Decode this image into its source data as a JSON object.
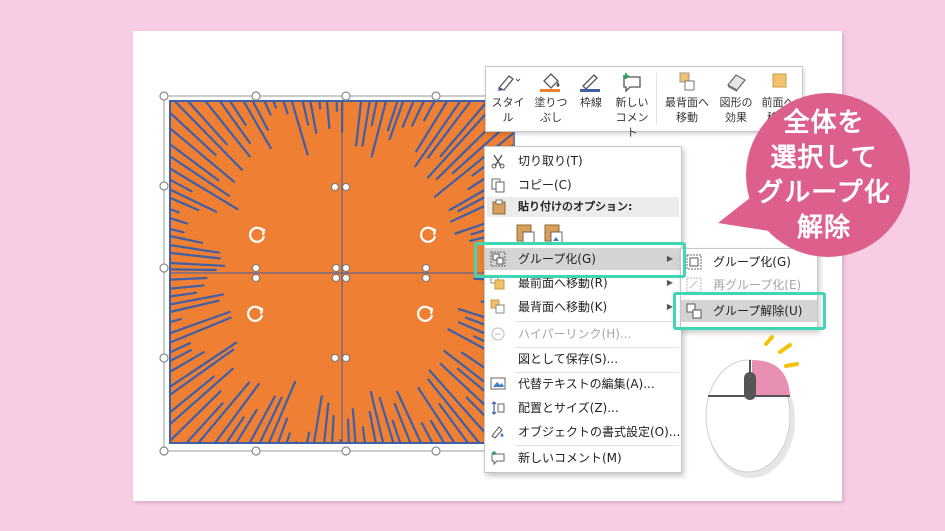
{
  "slide": {
    "colors": {
      "page_bg": "#f9cce6",
      "burst_fill": "#ee7f33",
      "burst_lines": "#3f5fa6",
      "highlight": "#3ed6b4",
      "callout": "#dd5f8c",
      "menu_hover": "#d4d4d4"
    }
  },
  "toolbar": {
    "style": {
      "line1": "スタイル",
      "line2": "",
      "icon": "style-brush-icon"
    },
    "fill": {
      "line1": "塗りつ",
      "line2": "ぶし",
      "icon": "paint-bucket-icon"
    },
    "outline": {
      "line1": "枠線",
      "line2": "",
      "icon": "pen-outline-icon"
    },
    "new_comment": {
      "line1": "新しい",
      "line2": "コメント",
      "icon": "comment-icon"
    },
    "send_back": {
      "line1": "最背面へ",
      "line2": "移動",
      "icon": "send-to-back-icon"
    },
    "effects": {
      "line1": "図形の",
      "line2": "効果",
      "icon": "shape-effects-icon"
    },
    "bring_front": {
      "line1": "前面へ",
      "line2": "移動",
      "icon": "bring-forward-icon"
    }
  },
  "context_menu": {
    "cut": "切り取り(T)",
    "copy": "コピー(C)",
    "paste_options": "貼り付けのオプション:",
    "group": "グループ化(G)",
    "bring_to_front": "最前面へ移動(R)",
    "send_to_back": "最背面へ移動(K)",
    "hyperlink": "ハイパーリンク(H)...",
    "save_as_picture": "図として保存(S)...",
    "edit_alt_text": "代替テキストの編集(A)...",
    "size_position": "配置とサイズ(Z)...",
    "format_object": "オブジェクトの書式設定(O)...",
    "new_comment": "新しいコメント(M)"
  },
  "submenu": {
    "group": "グループ化(G)",
    "regroup": "再グループ化(E)",
    "ungroup": "グループ解除(U)"
  },
  "callout": {
    "line1": "全体を",
    "line2": "選択して",
    "line3": "グループ化",
    "line4": "解除"
  }
}
